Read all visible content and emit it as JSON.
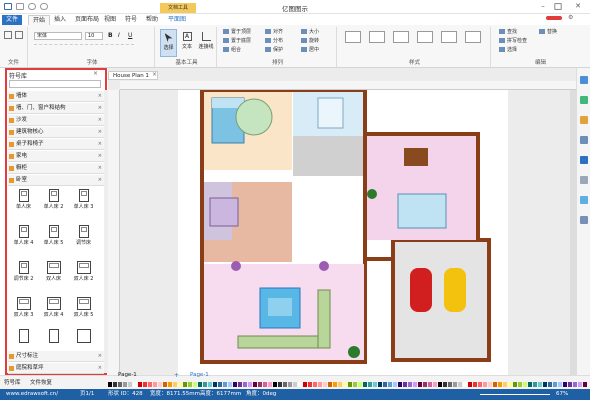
{
  "window": {
    "title": "亿图图示",
    "menus": [
      "文件",
      "开始",
      "插入",
      "页面布局",
      "视图",
      "符号",
      "帮助"
    ],
    "context_tab": {
      "group": "文档工具",
      "name": "平面图"
    }
  },
  "ribbon": {
    "font": {
      "family": "宋体",
      "size": "10"
    },
    "tools": {
      "select": "选择",
      "text": "文本",
      "connector": "连接线"
    },
    "arrange": [
      "置于顶层",
      "置于底层",
      "对齐",
      "分布",
      "大小",
      "旋转",
      "居中",
      "组合",
      "保护"
    ],
    "edit": [
      "查找",
      "替换",
      "拼写检查",
      "选择"
    ],
    "groups": [
      "文件",
      "字体",
      "基本工具",
      "排列",
      "样式",
      "编辑"
    ]
  },
  "library": {
    "title": "符号库",
    "categories_top": [
      "墙体",
      "墙、门、窗户和结构",
      "沙发",
      "建筑物核心",
      "桌子和椅子",
      "家电",
      "橱柜",
      "卧室"
    ],
    "shapes": [
      "单人床",
      "单人床 2",
      "单人床 3",
      "单人床 4",
      "单人床 5",
      "调节床",
      "调节床 2",
      "双人床",
      "双人床 2",
      "双人床 3",
      "双人床 4",
      "双人床 5"
    ],
    "categories_bottom": [
      "尺寸标注",
      "庭院和草坪"
    ]
  },
  "document_tab": "House Plan 1",
  "page_tabs": {
    "current": "Page-1",
    "active": "Page-1"
  },
  "bottom_panels": [
    "符号库",
    "文件恢复"
  ],
  "status": {
    "url": "www.edrawsoft.cn/",
    "page": "页1/1",
    "shape_id": "形状 ID：428",
    "width": "宽度：8171.55mm",
    "height": "高度：6177mm",
    "angle": "角度：0deg",
    "zoom": "67%"
  },
  "colors": {
    "statusbar": "#1f5fa3",
    "library_border": "#e23b3b",
    "wall": "#8a3e17",
    "accent": "#2b73c2"
  },
  "icons": [
    "save-icon",
    "undo-icon",
    "redo-icon",
    "select-icon",
    "text-icon",
    "connector-icon",
    "find-icon",
    "close-icon"
  ]
}
